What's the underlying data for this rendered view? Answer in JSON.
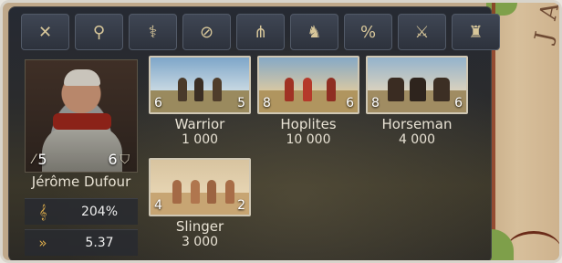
{
  "toolbar": {
    "buttons": [
      {
        "icon": "crossed-arrows-icon",
        "glyph": "✕"
      },
      {
        "icon": "map-pin-icon",
        "glyph": "⚲"
      },
      {
        "icon": "shepherd-crook-icon",
        "glyph": "⚕"
      },
      {
        "icon": "no-entry-icon",
        "glyph": "⊘"
      },
      {
        "icon": "fence-icon",
        "glyph": "⋔"
      },
      {
        "icon": "soldiers-icon",
        "glyph": "♞"
      },
      {
        "icon": "percent-icon",
        "glyph": "%"
      },
      {
        "icon": "swords-soldiers-icon",
        "glyph": "⚔"
      },
      {
        "icon": "soldiers-disband-icon",
        "glyph": "♜"
      }
    ]
  },
  "general": {
    "name": "Jérôme Dufour",
    "martial": "5",
    "defense": "6",
    "morale": "204%",
    "speed": "5.37"
  },
  "units": [
    {
      "name": "Warrior",
      "count": "1 000",
      "left_num": "6",
      "right_num": "5"
    },
    {
      "name": "Hoplites",
      "count": "10 000",
      "left_num": "8",
      "right_num": "6"
    },
    {
      "name": "Horseman",
      "count": "4 000",
      "left_num": "8",
      "right_num": "6"
    },
    {
      "name": "Slinger",
      "count": "3 000",
      "left_num": "4",
      "right_num": "2"
    }
  ],
  "map": {
    "label": "JAC"
  },
  "colors": {
    "accent": "#d7a84a",
    "panel": "#2a2b2d",
    "map": "#c9ae89"
  }
}
